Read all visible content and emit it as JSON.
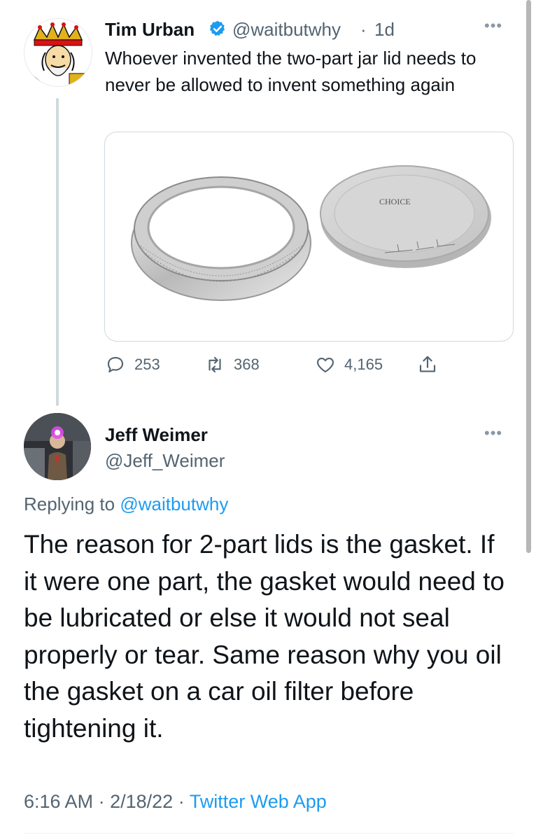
{
  "tweet": {
    "author_name": "Tim Urban",
    "handle": "@waitbutwhy",
    "separator": "·",
    "time": "1d",
    "text": "Whoever invented the two-part jar lid needs to never be allowed to invent something again",
    "image": {
      "lid_brand": "CHOICE"
    },
    "actions": {
      "reply_count": "253",
      "retweet_count": "368",
      "like_count": "4,165"
    }
  },
  "reply": {
    "author_name": "Jeff Weimer",
    "handle": "@Jeff_Weimer",
    "replying_label": "Replying to",
    "replying_to": "@waitbutwhy",
    "text": "The reason for 2-part lids is the gasket. If it were one part, the gasket would need to be lubricated or else it would not seal properly or tear. Same reason why you oil the gasket on a car oil filter before tightening it.",
    "timestamp": "6:16 AM",
    "sep": "·",
    "date": "2/18/22",
    "source": "Twitter Web App"
  },
  "icons": {
    "verified": "verified-badge-icon",
    "more": "more-icon",
    "reply": "reply-icon",
    "retweet": "retweet-icon",
    "like": "heart-icon",
    "share": "share-icon"
  },
  "colors": {
    "link": "#1d9bf0",
    "muted": "#536471",
    "text": "#0f1419"
  }
}
